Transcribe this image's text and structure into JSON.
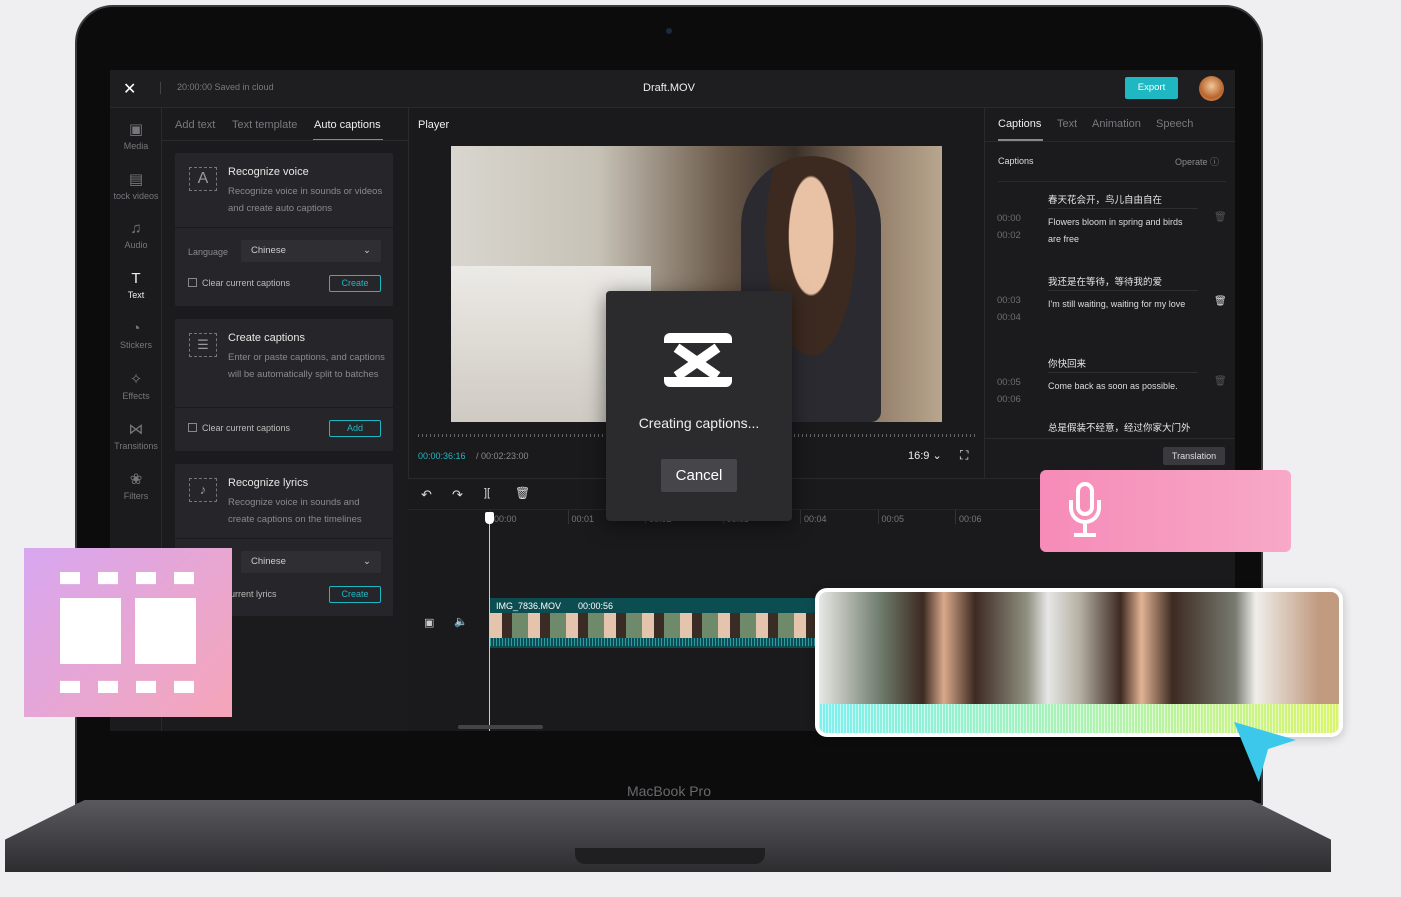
{
  "device": {
    "label": "MacBook Pro"
  },
  "topbar": {
    "saved": "20:00:00 Saved in cloud",
    "title": "Draft.MOV",
    "export": "Export"
  },
  "sidebar": {
    "items": [
      {
        "label": "Media",
        "icon": "media-icon",
        "glyph": "▣"
      },
      {
        "label": "tock videos",
        "icon": "stock-videos-icon",
        "glyph": "▤"
      },
      {
        "label": "Audio",
        "icon": "audio-icon",
        "glyph": "♫"
      },
      {
        "label": "Text",
        "icon": "text-icon",
        "glyph": "T"
      },
      {
        "label": "Stickers",
        "icon": "stickers-icon",
        "glyph": "◔"
      },
      {
        "label": "Effects",
        "icon": "effects-icon",
        "glyph": "✧"
      },
      {
        "label": "Transitions",
        "icon": "transitions-icon",
        "glyph": "⋈"
      },
      {
        "label": "Filters",
        "icon": "filters-icon",
        "glyph": "❀"
      }
    ]
  },
  "left_panel": {
    "tabs": [
      "Add text",
      "Text template",
      "Auto captions"
    ],
    "active_tab": "Auto captions",
    "recognize_voice": {
      "title": "Recognize voice",
      "desc": "Recognize voice in sounds or videos and create auto captions",
      "language_label": "Language",
      "language": "Chinese",
      "clear": "Clear current captions",
      "button": "Create"
    },
    "create_captions": {
      "title": "Create captions",
      "desc": "Enter or paste captions, and captions will be automatically split to batches",
      "clear": "Clear current captions",
      "button": "Add"
    },
    "recognize_lyrics": {
      "title": "Recognize lyrics",
      "desc": "Recognize voice in sounds and create captions on the timelines",
      "language": "Chinese",
      "clear": "urrent lyrics",
      "button": "Create"
    }
  },
  "player": {
    "label": "Player",
    "current": "00:00:36:16",
    "total": "/ 00:02:23:00",
    "ratio": "16:9"
  },
  "dialog": {
    "message": "Creating captions...",
    "cancel": "Cancel"
  },
  "timeline": {
    "ticks": [
      "00:00",
      "00:01",
      "00:02",
      "00:03",
      "00:04",
      "00:05",
      "00:06"
    ],
    "clip_name": "IMG_7836.MOV",
    "clip_duration": "00:00:56"
  },
  "right_panel": {
    "tabs": [
      "Captions",
      "Text",
      "Animation",
      "Speech"
    ],
    "active_tab": "Captions",
    "header": "Captions",
    "operate": "Operate",
    "captions": [
      {
        "start": "00:00",
        "end": "00:02",
        "zh": "春天花会开，鸟儿自由自在",
        "en": "Flowers bloom in spring and birds are free"
      },
      {
        "start": "00:03",
        "end": "00:04",
        "zh": "我还是在等待，等待我的爱",
        "en": "I'm still waiting, waiting for my love"
      },
      {
        "start": "00:05",
        "end": "00:06",
        "zh": "你快回来",
        "en": "Come back as soon as possible."
      },
      {
        "zh": "总是假装不经意，经过你家大门外"
      }
    ],
    "translation": "Translation"
  },
  "colors": {
    "accent": "#1fb7c2",
    "mic_card": "#f58fb9",
    "film_card_start": "#d9a8f0",
    "film_card_end": "#f7a6b8",
    "cursor": "#3cc8ea"
  }
}
